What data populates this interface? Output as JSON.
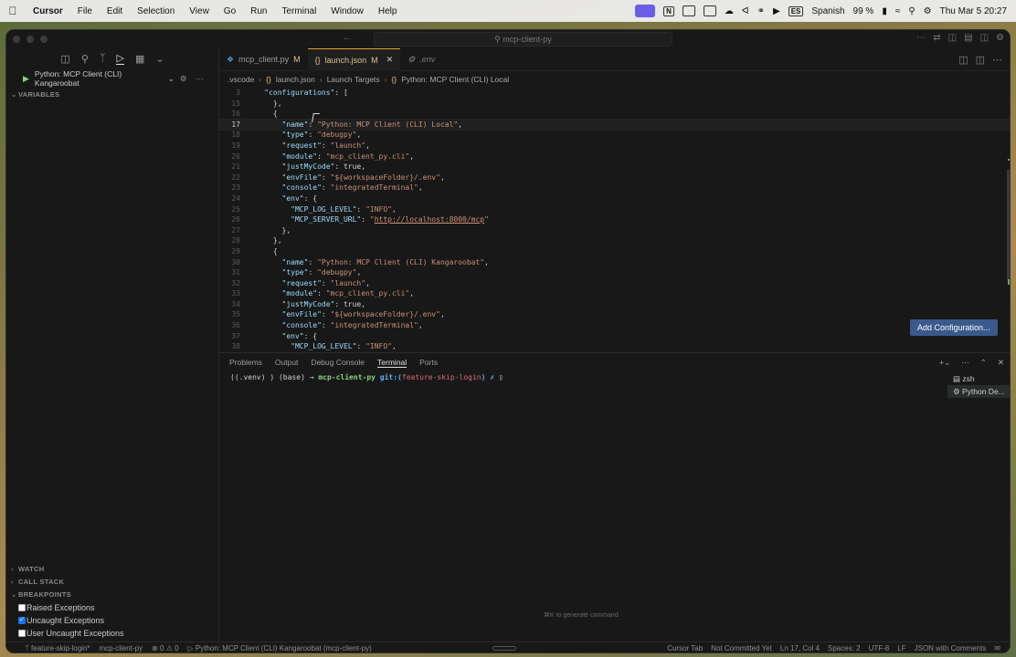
{
  "menubar": {
    "apple": "",
    "items": [
      "Cursor",
      "File",
      "Edit",
      "Selection",
      "View",
      "Go",
      "Run",
      "Terminal",
      "Window",
      "Help"
    ],
    "input_source": "Spanish",
    "input_badge": "ES",
    "notion_badge": "N",
    "battery": "99 %",
    "clock": "Thu Mar 5  20:27"
  },
  "window": {
    "search_text": "mcp-client-py"
  },
  "sidebar": {
    "run_config": "Python: MCP Client (CLI) Kangaroobat",
    "variables_label": "VARIABLES",
    "watch_label": "WATCH",
    "callstack_label": "CALL STACK",
    "breakpoints_label": "BREAKPOINTS",
    "breakpoints": [
      {
        "label": "Raised Exceptions",
        "checked": false
      },
      {
        "label": "Uncaught Exceptions",
        "checked": true
      },
      {
        "label": "User Uncaught Exceptions",
        "checked": false
      }
    ]
  },
  "tabs": [
    {
      "label": "mcp_client.py",
      "modified": "M",
      "active": false
    },
    {
      "label": "launch.json",
      "modified": "M",
      "active": true
    },
    {
      "label": ".env",
      "modified": "",
      "active": false
    }
  ],
  "breadcrumb": {
    "folder": ".vscode",
    "file": "launch.json",
    "node1": "Launch Targets",
    "node2": "Python: MCP Client (CLI) Local"
  },
  "editor": {
    "current_line": 17,
    "add_config_label": "Add Configuration..."
  },
  "panel": {
    "tabs": [
      "Problems",
      "Output",
      "Debug Console",
      "Terminal",
      "Ports"
    ],
    "active_tab": "Terminal",
    "prompt_env": "((.venv) ) (base) →",
    "prompt_dir": "mcp-client-py",
    "prompt_git": "git:(",
    "prompt_branch": "feature-skip-login",
    "prompt_end": ") ✗",
    "terminals": [
      "zsh",
      "Python De..."
    ],
    "hint": "⌘K to generate command"
  },
  "statusbar": {
    "branch": "feature-skip-login*",
    "project": "mcp-client-py",
    "problems": "⊗ 0 ⚠ 0",
    "debug_target": "Python: MCP Client (CLI) Kangaroobat (mcp-client-py)",
    "cursor_tab": "Cursor Tab",
    "commit": "Not Committed Yet",
    "position": "Ln 17, Col 4",
    "spaces": "Spaces: 2",
    "encoding": "UTF-8",
    "eol": "LF",
    "language": "JSON with Comments"
  }
}
